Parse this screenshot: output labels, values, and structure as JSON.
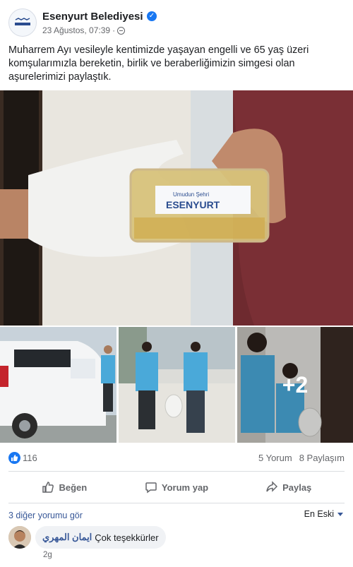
{
  "post": {
    "author": "Esenyurt Belediyesi",
    "date": "23 Ağustos, 07:39",
    "separator": "·",
    "text": "Muharrem Ayı vesileyle kentimizde yaşayan engelli ve 65 yaş üzeri komşularımızla bereketin, birlik ve beraberliğimizin simgesi olan aşurelerimizi paylaştık.",
    "avatar_label": "ESENYURT",
    "package_label_small": "Umudun Şehri",
    "package_label_big": "ESENYURT",
    "more_photos": "+2"
  },
  "stats": {
    "likes": "116",
    "comments": "5 Yorum",
    "shares": "8 Paylaşım"
  },
  "actions": {
    "like": "Beğen",
    "comment": "Yorum yap",
    "share": "Paylaş"
  },
  "comments": {
    "see_more": "3 diğer yorumu gör",
    "sort": "En Eski",
    "items": [
      {
        "author": "ايمان المهري",
        "text": "Çok teşekkürler",
        "time": "2g"
      }
    ]
  },
  "colors": {
    "accent": "#1877f2",
    "link": "#385898",
    "muted": "#65676b"
  },
  "icons": [
    "globe-icon",
    "verified-icon",
    "like-icon",
    "comment-icon",
    "share-icon",
    "chevron-down-icon"
  ]
}
